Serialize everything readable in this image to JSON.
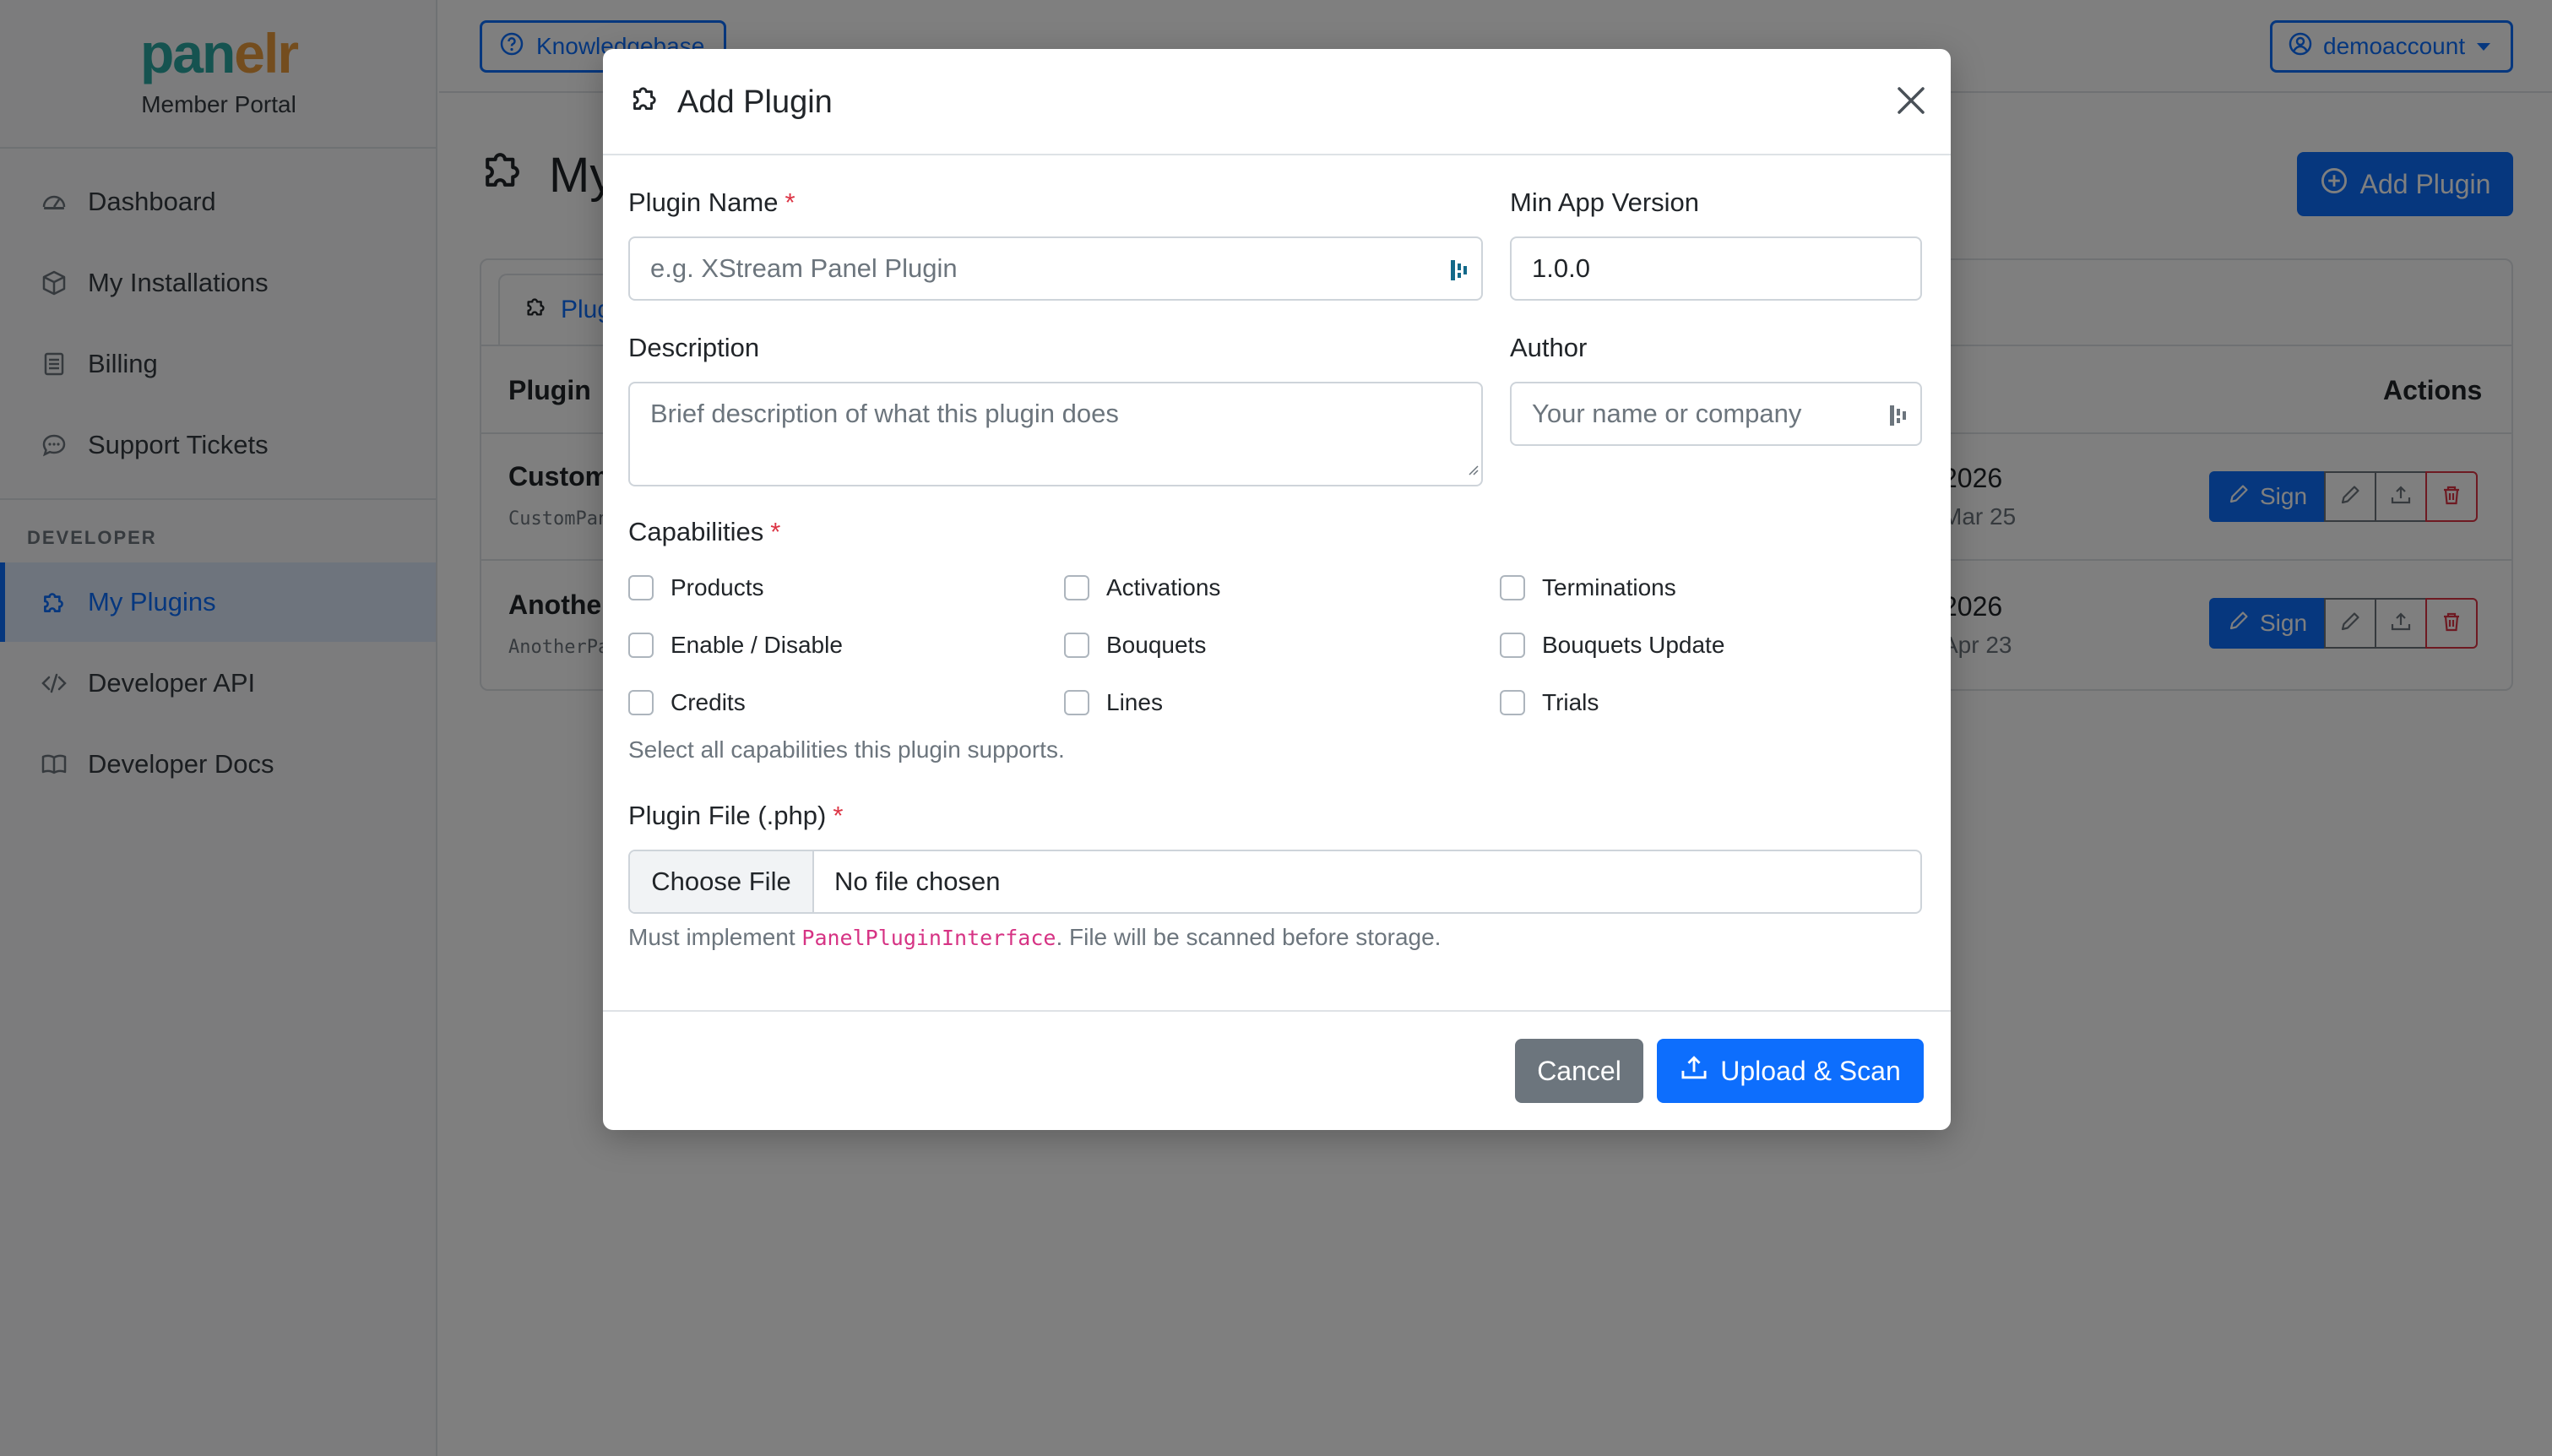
{
  "brand": {
    "logo_part1": "pan",
    "logo_part2": "elr",
    "subtitle": "Member Portal"
  },
  "sidebar": {
    "items": [
      {
        "label": "Dashboard",
        "icon": "gauge-icon"
      },
      {
        "label": "My Installations",
        "icon": "box-icon"
      },
      {
        "label": "Billing",
        "icon": "receipt-icon"
      },
      {
        "label": "Support Tickets",
        "icon": "chat-icon"
      }
    ],
    "developer_heading": "DEVELOPER",
    "dev_items": [
      {
        "label": "My Plugins",
        "icon": "puzzle-icon",
        "active": true
      },
      {
        "label": "Developer API",
        "icon": "code-icon"
      },
      {
        "label": "Developer Docs",
        "icon": "book-icon"
      }
    ]
  },
  "topbar": {
    "knowledgebase_label": "Knowledgebase",
    "account_label": "demoaccount"
  },
  "page": {
    "title": "My Plugins",
    "add_plugin_label": "Add Plugin",
    "tab_label": "Plugins",
    "table": {
      "col_plugin": "Plugin",
      "col_actions": "Actions",
      "rows": [
        {
          "name": "CustomPanel",
          "code": "CustomPanel",
          "date": "2026",
          "date_sub": "Mar 25",
          "sign_label": "Sign"
        },
        {
          "name": "AnotherPanel",
          "code": "AnotherPanel",
          "date": "2026",
          "date_sub": "Apr 23",
          "sign_label": "Sign"
        }
      ]
    }
  },
  "modal": {
    "title": "Add Plugin",
    "plugin_name": {
      "label": "Plugin Name",
      "placeholder": "e.g. XStream Panel Plugin"
    },
    "min_app_version": {
      "label": "Min App Version",
      "value": "1.0.0"
    },
    "description": {
      "label": "Description",
      "placeholder": "Brief description of what this plugin does"
    },
    "author": {
      "label": "Author",
      "placeholder": "Your name or company"
    },
    "capabilities": {
      "label": "Capabilities",
      "options": [
        "Products",
        "Activations",
        "Terminations",
        "Enable / Disable",
        "Bouquets",
        "Bouquets Update",
        "Credits",
        "Lines",
        "Trials"
      ],
      "help": "Select all capabilities this plugin supports."
    },
    "plugin_file": {
      "label": "Plugin File (.php)",
      "choose_label": "Choose File",
      "status": "No file chosen",
      "help_prefix": "Must implement ",
      "help_code": "PanelPluginInterface",
      "help_suffix": ". File will be scanned before storage."
    },
    "required_marker": "*",
    "cancel_label": "Cancel",
    "upload_label": "Upload & Scan"
  },
  "colors": {
    "primary": "#0d6efd",
    "secondary": "#6c757d",
    "danger": "#dc3545",
    "required": "#dc3545",
    "code": "#d63384"
  }
}
